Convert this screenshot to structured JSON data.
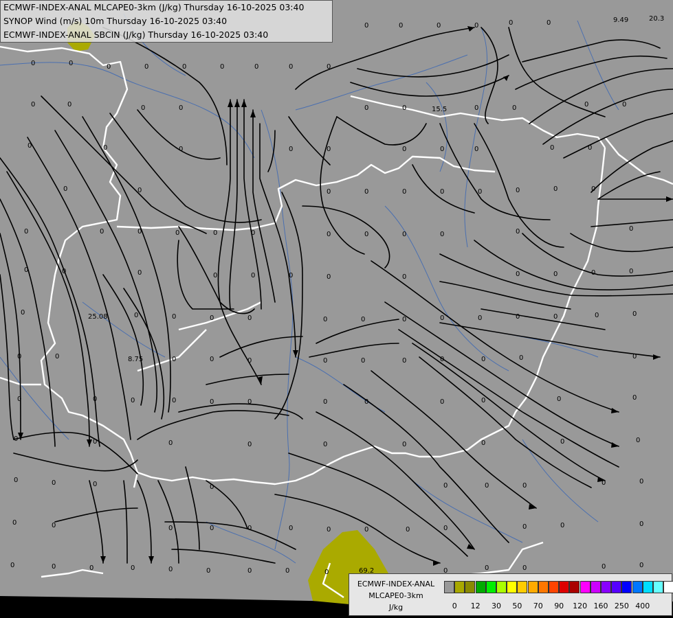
{
  "header": {
    "line1": "ECMWF-INDEX-ANAL MLCAPE0-3km (J/kg) Thursday 16-10-2025 03:40",
    "line2": "SYNOP Wind (m/s) 10m Thursday 16-10-2025 03:40",
    "line3": "ECMWF-INDEX-ANAL SBCIN (J/kg) Thursday 16-10-2025 03:40"
  },
  "legend": {
    "title1": "ECMWF-INDEX-ANAL",
    "title2": "MLCAPE0-3km",
    "unit": "J/kg",
    "colors": [
      "#999999",
      "#a8a800",
      "#8a8a00",
      "#00aa00",
      "#00ee00",
      "#aaff00",
      "#ffff00",
      "#ffcc00",
      "#ffaa00",
      "#ff7700",
      "#ff4400",
      "#dd0000",
      "#aa0000",
      "#ff00ff",
      "#cc00ff",
      "#8800ff",
      "#5500ff",
      "#0000ff",
      "#0077ff",
      "#00ddff",
      "#66ffff",
      "#ffffff"
    ],
    "ticks": [
      "0",
      "12",
      "30",
      "50",
      "70",
      "90",
      "120",
      "160",
      "250",
      "400"
    ]
  },
  "map": {
    "background": "#999999",
    "cape_color": "#aaaa00",
    "border_color": "#ffffff",
    "river_color": "#4a6fb0",
    "streamline_color": "#000000",
    "value_labels": [
      {
        "text": "9.49"
      },
      {
        "text": "20.3"
      },
      {
        "text": "15.5"
      },
      {
        "text": "25.08"
      },
      {
        "text": "8.75"
      },
      {
        "text": "69.2"
      }
    ],
    "zero_label": "0"
  }
}
